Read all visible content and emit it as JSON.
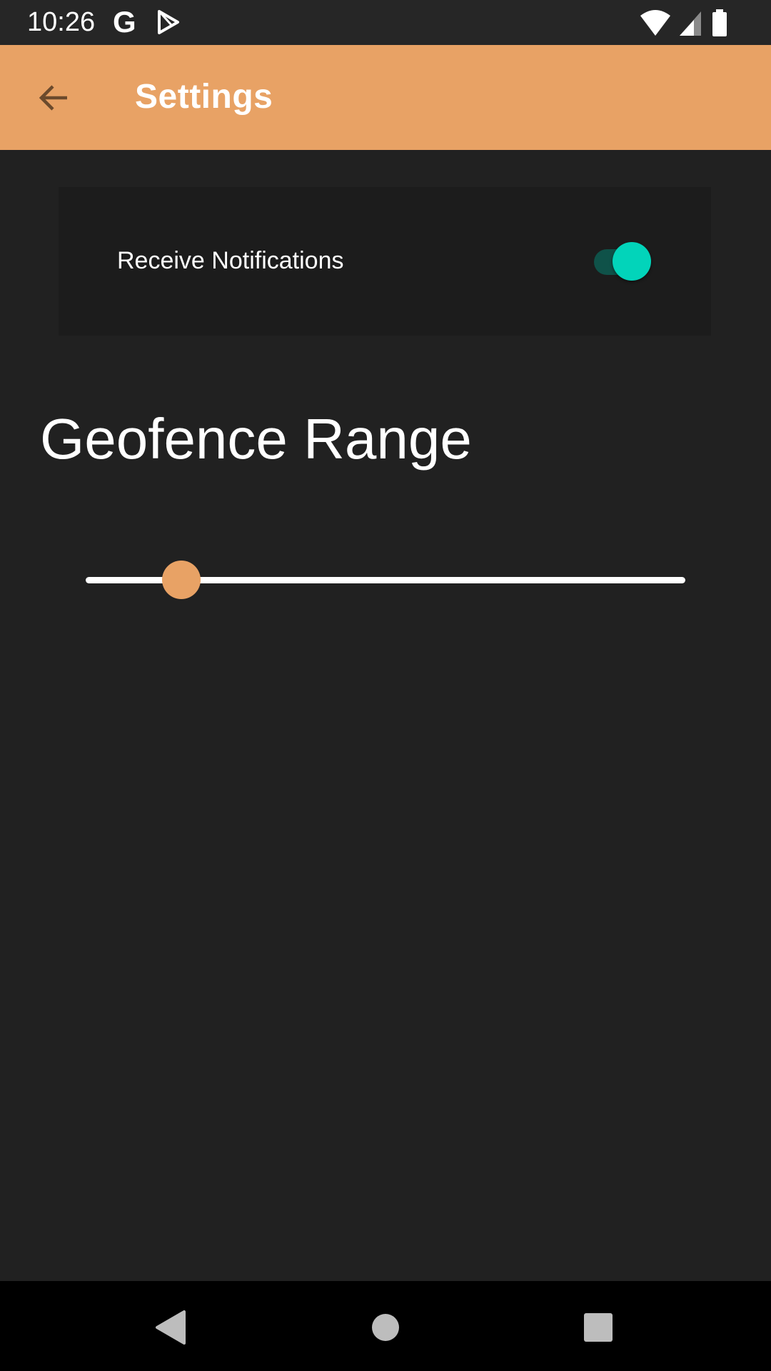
{
  "status_bar": {
    "time": "10:26",
    "google_glyph": "G",
    "icons": [
      "google-icon",
      "play-store-icon",
      "wifi-icon",
      "cell-signal-icon",
      "battery-icon"
    ]
  },
  "app_bar": {
    "title": "Settings",
    "back_icon": "arrow-back-icon",
    "color": "#E8A265"
  },
  "notifications": {
    "label": "Receive Notifications",
    "enabled": true,
    "switch_color": "#02D4BA"
  },
  "geofence": {
    "heading": "Geofence Range",
    "slider_value": 0.16,
    "slider_color": "#E8A265"
  },
  "nav_bar": {
    "buttons": [
      "back-triangle-icon",
      "home-circle-icon",
      "recents-square-icon"
    ]
  }
}
